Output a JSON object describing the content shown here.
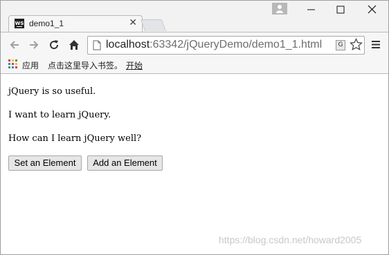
{
  "browser": {
    "tab": {
      "title": "demo1_1",
      "close_glyph": "✕",
      "favicon_text": "WS"
    },
    "window_controls": [
      "minimize-icon",
      "maximize-icon",
      "close-icon"
    ],
    "address": {
      "host": "localhost",
      "rest": ":63342/jQueryDemo/demo1_1.html"
    },
    "translate_glyph": "G",
    "bookmarks": {
      "apps_label": "应用",
      "import_label": "点击这里导入书签。",
      "start_label": "开始"
    }
  },
  "page": {
    "paragraphs": [
      "jQuery is so useful.",
      "I want to learn jQuery.",
      "How can I learn jQuery well?"
    ],
    "buttons": {
      "set_label": "Set an Element",
      "add_label": "Add an Element"
    }
  },
  "watermark": "https://blog.csdn.net/howard2005",
  "colors": {
    "chrome_bg": "#f2f2f2",
    "toolbar_bg": "#f6f6f6",
    "button_bg": "#e6e6e6"
  }
}
